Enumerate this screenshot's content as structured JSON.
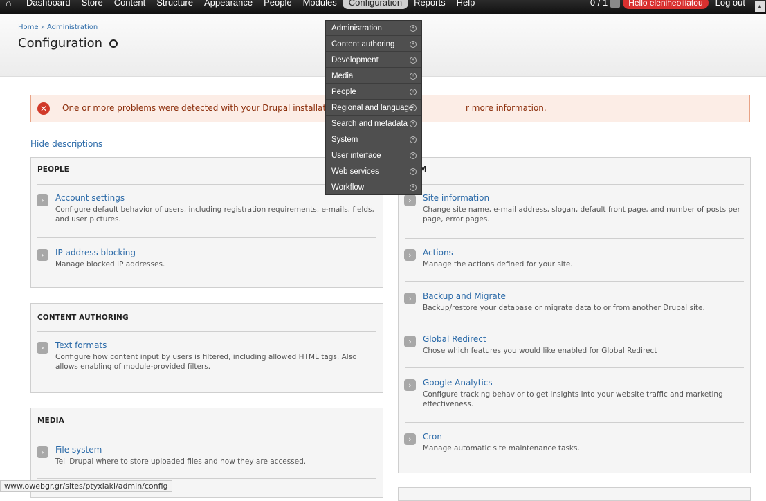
{
  "toolbar": {
    "home_icon": "home-icon",
    "menu": [
      "Dashboard",
      "Store",
      "Content",
      "Structure",
      "Appearance",
      "People",
      "Modules",
      "Configuration",
      "Reports",
      "Help"
    ],
    "count": "0 / 1",
    "hello": "Hello eleniheoiiiatou",
    "logout": "Log out"
  },
  "header": {
    "breadcrumb_home": "Home",
    "breadcrumb_sep": " » ",
    "breadcrumb_admin": "Administration",
    "title": "Configuration"
  },
  "message": {
    "text_start": "One or more problems were detected with your Drupal installation. C",
    "text_end": "r more information."
  },
  "hide_descriptions": "Hide descriptions",
  "dropdown": [
    "Administration",
    "Content authoring",
    "Development",
    "Media",
    "People",
    "Regional and language",
    "Search and metadata",
    "System",
    "User interface",
    "Web services",
    "Workflow"
  ],
  "panels": {
    "people": {
      "title": "PEOPLE",
      "items": [
        {
          "title": "Account settings",
          "desc": "Configure default behavior of users, including registration requirements, e-mails, fields, and user pictures."
        },
        {
          "title": "IP address blocking",
          "desc": "Manage blocked IP addresses."
        }
      ]
    },
    "content": {
      "title": "CONTENT AUTHORING",
      "items": [
        {
          "title": "Text formats",
          "desc": "Configure how content input by users is filtered, including allowed HTML tags. Also allows enabling of module-provided filters."
        }
      ]
    },
    "media": {
      "title": "MEDIA",
      "items": [
        {
          "title": "File system",
          "desc": "Tell Drupal where to store uploaded files and how they are accessed."
        }
      ]
    },
    "system": {
      "title": "SYSTEM",
      "title_visible": "EM",
      "items": [
        {
          "title": "Site information",
          "desc": "Change site name, e-mail address, slogan, default front page, and number of posts per page, error pages."
        },
        {
          "title": "Actions",
          "desc": "Manage the actions defined for your site."
        },
        {
          "title": "Backup and Migrate",
          "desc": "Backup/restore your database or migrate data to or from another Drupal site."
        },
        {
          "title": "Global Redirect",
          "desc": "Chose which features you would like enabled for Global Redirect"
        },
        {
          "title": "Google Analytics",
          "desc": "Configure tracking behavior to get insights into your website traffic and marketing effectiveness."
        },
        {
          "title": "Cron",
          "desc": "Manage automatic site maintenance tasks."
        }
      ]
    }
  },
  "status_url": "www.owebgr.gr/sites/ptyxiaki/admin/config",
  "colors": {
    "link": "#2b6aa8",
    "error": "#d13a2a",
    "toolbar": "#1a1a1a"
  }
}
